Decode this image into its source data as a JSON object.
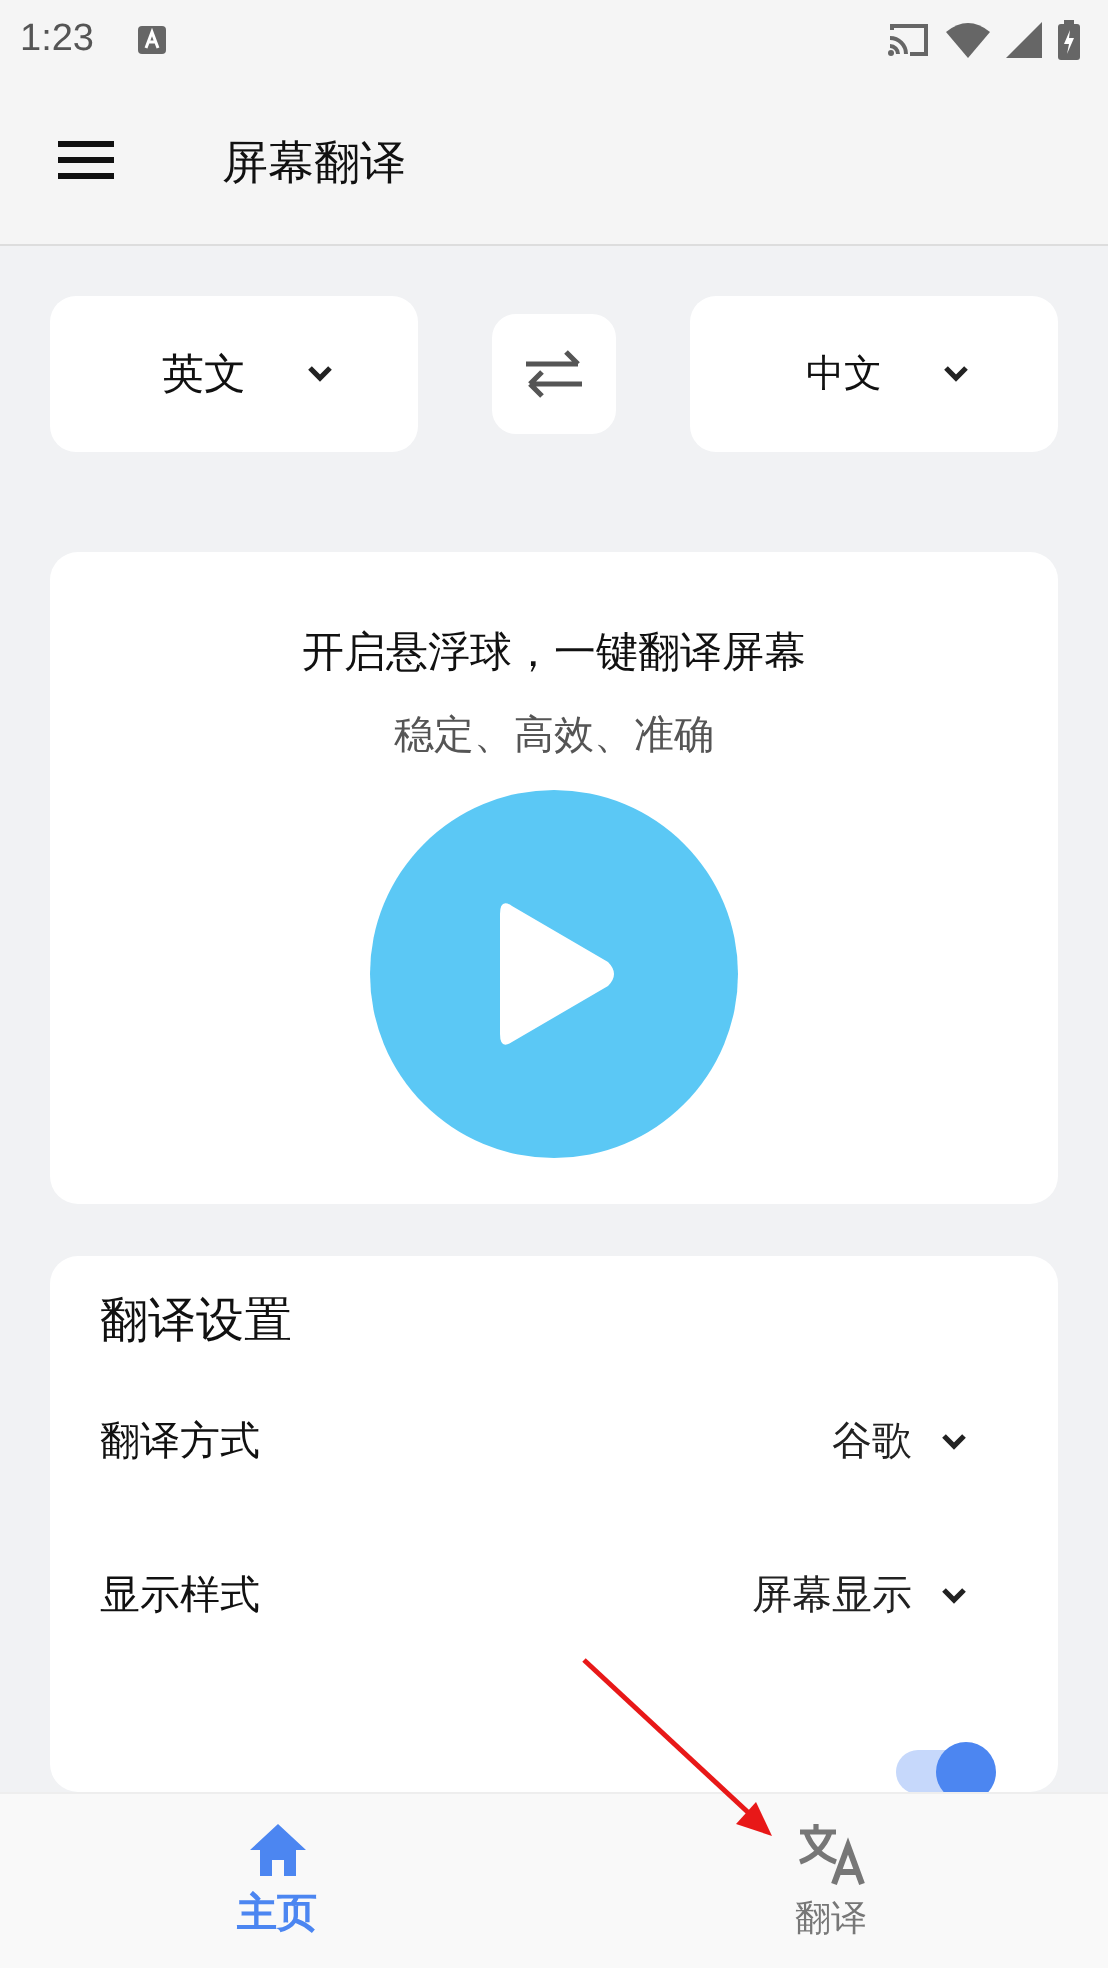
{
  "status_bar": {
    "time": "1:23"
  },
  "app_bar": {
    "title": "屏幕翻译"
  },
  "languages": {
    "source": "英文",
    "target": "中文"
  },
  "promo": {
    "title": "开启悬浮球，一键翻译屏幕",
    "subtitle": "稳定、高效、准确"
  },
  "settings": {
    "title": "翻译设置",
    "rows": [
      {
        "kind": "dropdown",
        "label": "翻译方式",
        "value": "谷歌"
      },
      {
        "kind": "dropdown",
        "label": "显示样式",
        "value": "屏幕显示"
      },
      {
        "kind": "toggle",
        "on": true
      }
    ]
  },
  "nav": [
    {
      "label": "主页",
      "selected": true
    },
    {
      "label": "翻译",
      "selected": false
    }
  ]
}
